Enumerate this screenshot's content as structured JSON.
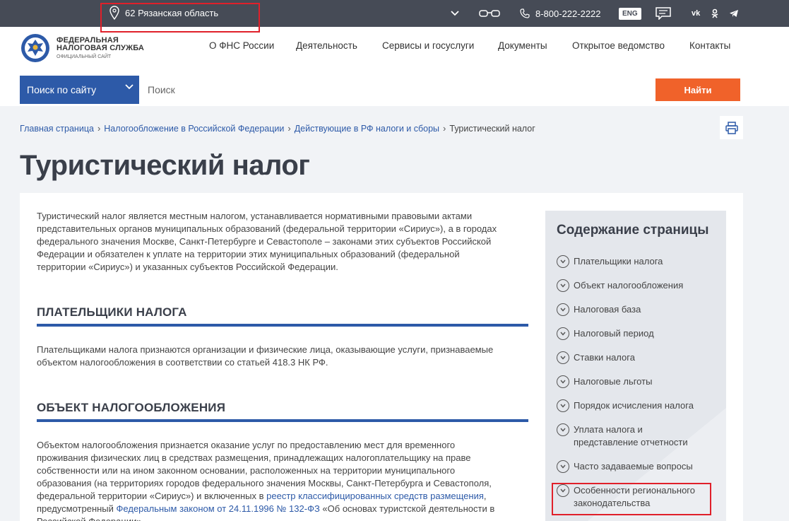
{
  "topbar": {
    "region": "62 Рязанская область",
    "phone": "8-800-222-2222",
    "lang": "ENG",
    "social": [
      "vk-icon",
      "ok-icon",
      "telegram-icon"
    ]
  },
  "header": {
    "logo_line1": "ФЕДЕРАЛЬНАЯ",
    "logo_line2": "НАЛОГОВАЯ СЛУЖБА",
    "logo_line3": "ОФИЦИАЛЬНЫЙ САЙТ",
    "nav": [
      "О ФНС России",
      "Деятельность",
      "Сервисы и госуслуги",
      "Документы",
      "Открытое ведомство",
      "Контакты"
    ]
  },
  "search": {
    "scope": "Поиск по сайту",
    "placeholder": "Поиск",
    "button": "Найти"
  },
  "breadcrumb": [
    "Главная страница",
    "Налогообложение в Российской Федерации",
    "Действующие в РФ налоги и сборы",
    "Туристический налог"
  ],
  "page_title": "Туристический налог",
  "content": {
    "intro_lines": [
      "Туристический налог является местным налогом, устанавливается нормативными правовыми актами",
      "представительных органов муниципальных образований (федеральной территории «Сириус»), а в городах",
      "федерального значения Москве, Санкт-Петербурге и Севастополе – законами этих субъектов Российской",
      "Федерации и обязателен к уплате на территории этих муниципальных образований (федеральной",
      "территории «Сириус») и указанных субъектов Российской Федерации."
    ],
    "section1_title": "ПЛАТЕЛЬЩИКИ НАЛОГА",
    "section1_lines": [
      "Плательщиками налога признаются организации и физические лица, оказывающие услуги, признаваемые",
      "объектом налогообложения в соответствии со статьей 418.3 НК РФ."
    ],
    "section2_title": "ОБЪЕКТ НАЛОГООБЛОЖЕНИЯ",
    "section2_lines": [
      "Объектом налогообложения признается оказание услуг по предоставлению мест для временного",
      "проживания физических лиц в средствах размещения, принадлежащих налогоплательщику на праве",
      "собственности или на ином законном основании, расположенных на территории муниципального",
      "образования (на территориях городов федерального значения Москвы, Санкт-Петербурга и Севастополя,"
    ],
    "section2_line5_a": "федеральной территории «Сириус») и включенных в ",
    "section2_line5_link": "реестр классифицированных средств размещения",
    "section2_line5_b": ",",
    "section2_line6_a": "предусмотренный ",
    "section2_line6_link": "Федеральным законом от 24.11.1996 № 132-ФЗ",
    "section2_line6_b": " «Об основах туристской деятельности в",
    "section2_line7": "Российской Федерации»"
  },
  "toc": {
    "title": "Содержание страницы",
    "items": [
      "Плательщики налога",
      "Объект налогообложения",
      "Налоговая база",
      "Налоговый период",
      "Ставки налога",
      "Налоговые льготы",
      "Порядок исчисления налога",
      "Уплата налога и представление отчетности",
      "Часто задаваемые вопросы",
      "Особенности регионального законодательства"
    ]
  },
  "colors": {
    "topbar": "#464b56",
    "accent_blue": "#2d5aa8",
    "button_orange": "#f0622a",
    "highlight_red": "#e0202a"
  }
}
